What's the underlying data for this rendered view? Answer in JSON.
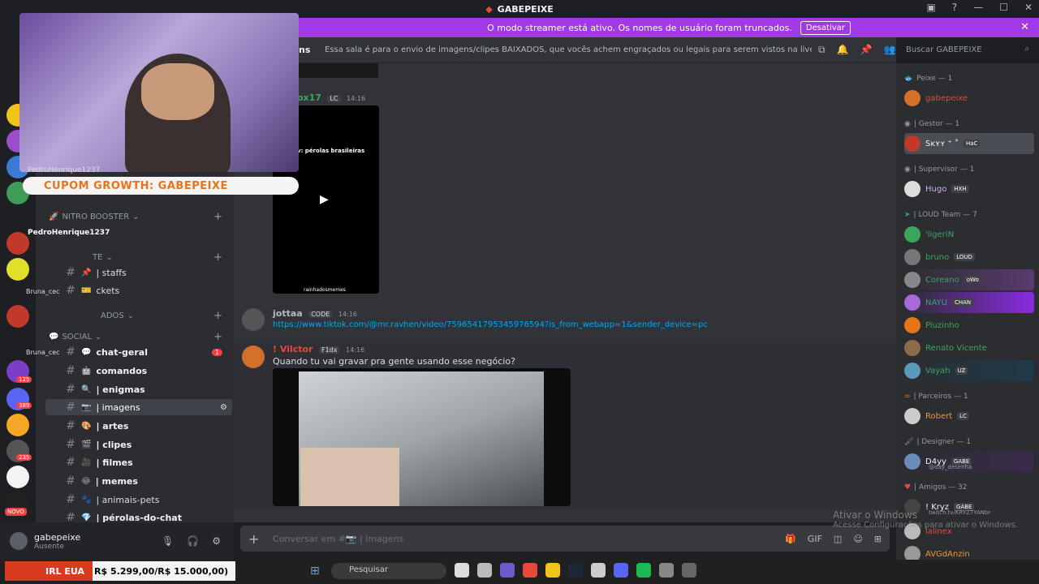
{
  "app": {
    "title": "GABEPEIXE"
  },
  "banner": {
    "text": "O modo streamer está ativo. Os nomes de usuário foram truncados.",
    "button": "Desativar"
  },
  "channel_header": {
    "name": "ns",
    "topic": "Essa sala é para o envio de imagens/clipes BAIXADOS, que vocês achem engraçados ou legais para serem vistos na live. Serão apagados prints de o..."
  },
  "search": {
    "placeholder": "Buscar GABEPEIXE"
  },
  "coupon": {
    "text": "CUPOM GROWTH: GABEPEIXE"
  },
  "overlay_names": [
    "PedroHenrique1237",
    "PedroHenrique1237",
    "Bruna_cec",
    "Bruna_cec"
  ],
  "categories": {
    "nitro": "NITRO BOOSTER",
    "social": "SOCIAL",
    "te": "TE",
    "ados": "ADOS"
  },
  "channels": [
    {
      "label": "| staffs",
      "emoji": "📌"
    },
    {
      "label": "ckets",
      "emoji": "🎫"
    },
    {
      "label": "chat-geral",
      "emoji": "💬",
      "badge": "1"
    },
    {
      "label": "comandos",
      "emoji": "🤖"
    },
    {
      "label": "| enigmas",
      "emoji": "🔍"
    },
    {
      "label": "| imagens",
      "emoji": "📷"
    },
    {
      "label": "| artes",
      "emoji": "🎨"
    },
    {
      "label": "| clipes",
      "emoji": "🎬"
    },
    {
      "label": "| filmes",
      "emoji": "🎥"
    },
    {
      "label": "| memes",
      "emoji": "😂"
    },
    {
      "label": "| animais-pets",
      "emoji": "🐾"
    },
    {
      "label": "| pérolas-do-chat",
      "emoji": "💎"
    }
  ],
  "server_badges": [
    "125",
    "389",
    "235"
  ],
  "server_new": "NOVO",
  "user": {
    "name": "gabepeixe",
    "status": "Ausente"
  },
  "messages": {
    "first": {
      "author": "ox17",
      "tag": "LC",
      "time": "14:16",
      "video_title": "v: pérolas brasileiras",
      "video_footer": "rainhadosmemes"
    },
    "second": {
      "author": "jottaa",
      "tag": "CODE",
      "time": "14:16",
      "link": "https://www.tiktok.com/@mr.ravhen/video/7596541795345976594?is_from_webapp=1&sender_device=pc"
    },
    "third": {
      "author": "! Vilctor",
      "tag": "F1dx",
      "time": "14:16",
      "text": "Quando tu vai gravar pra gente usando esse negócio?"
    }
  },
  "composer": {
    "placeholder": "Conversar em #📷 | imagens"
  },
  "members": {
    "cats": [
      {
        "label": "Peixe — 1"
      },
      {
        "label": "| Gestor — 1"
      },
      {
        "label": "| Supervisor — 1"
      },
      {
        "label": "| LOUD Team — 7"
      },
      {
        "label": "| Parceiros — 1"
      },
      {
        "label": "| Designer — 1"
      },
      {
        "label": "| Amigos — 32"
      }
    ],
    "list": [
      {
        "name": "gabepeixe",
        "color": "#e8483a"
      },
      {
        "name": "Sᴋʏʏ ⁺ ˚",
        "tag": "HaC",
        "color": "#f2f3f5"
      },
      {
        "name": "Hugo",
        "tag": "HXH",
        "color": "#d8a8f0"
      },
      {
        "name": "'ligeriN",
        "color": "#3ba55d"
      },
      {
        "name": "bruno",
        "tag": "LOUD",
        "color": "#3ba55d"
      },
      {
        "name": "Coreano",
        "tag": "oWo",
        "color": "#3ba55d"
      },
      {
        "name": "NAYU",
        "tag": "CHAN",
        "color": "#3ba55d"
      },
      {
        "name": "Piuzinho",
        "color": "#3ba55d"
      },
      {
        "name": "Renato Vicente",
        "color": "#3ba55d"
      },
      {
        "name": "Vayah",
        "tag": "UZ",
        "color": "#3ba55d"
      },
      {
        "name": "Robert",
        "tag": "LC",
        "color": "#e89a3a"
      },
      {
        "name": "D4yy",
        "tag": "GABE",
        "sub": "@day_desenha",
        "color": "#f2f3f5"
      },
      {
        "name": "! Kryz",
        "tag": "GABE",
        "sub": "twitch.tv/KRYZTYANbr",
        "color": "#f2f3f5"
      },
      {
        "name": "lalinex",
        "color": "#e8483a"
      },
      {
        "name": "AVGdAnzin",
        "color": "#e89a3a"
      }
    ]
  },
  "watermark": {
    "line1": "Ativar o Windows",
    "line2": "Acesse Configurações para ativar o Windows."
  },
  "taskbar": {
    "search": "Pesquisar",
    "irl_label": "IRL EUA",
    "irl_value": "R$ 5.299,00/R$ 15.000,00)"
  }
}
